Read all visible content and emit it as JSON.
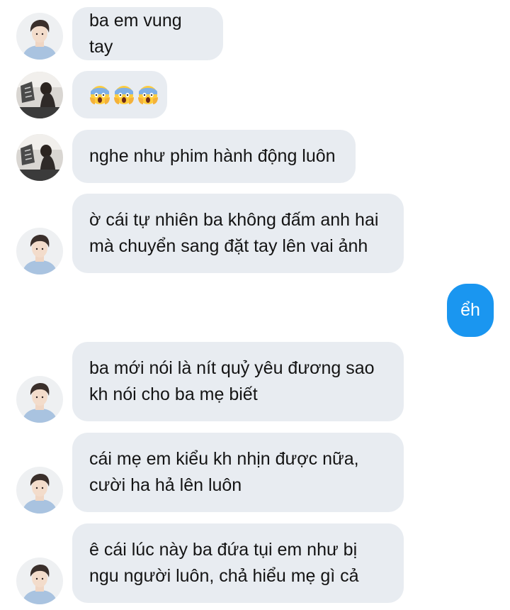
{
  "conversation": {
    "messages": [
      {
        "sender": "them",
        "avatar": "boy-avatar-icon",
        "text": "ba em vung tay"
      },
      {
        "sender": "them",
        "avatar": "girl-avatar-icon",
        "emojis": [
          "scream-emoji-icon",
          "scream-emoji-icon",
          "scream-emoji-icon"
        ]
      },
      {
        "sender": "them",
        "avatar": "girl-avatar-icon",
        "text": "nghe như phim hành động luôn"
      },
      {
        "sender": "them",
        "avatar": "boy-avatar-icon",
        "text": "ờ cái tự nhiên ba không đấm anh hai\nmà chuyển sang đặt tay lên vai ảnh"
      },
      {
        "sender": "me",
        "text": "ểh"
      },
      {
        "sender": "them",
        "avatar": "boy-avatar-icon",
        "text": "ba mới nói là nít quỷ yêu đương sao\nkh nói cho ba mẹ biết"
      },
      {
        "sender": "them",
        "avatar": "boy-avatar-icon",
        "text": "cái mẹ em kiểu kh nhịn được nữa,\ncười ha hả lên luôn"
      },
      {
        "sender": "them",
        "avatar": "boy-avatar-icon",
        "text": "ê cái lúc này ba đứa tụi em như bị\nngu người luôn, chả hiểu mẹ gì cả"
      }
    ]
  },
  "colors": {
    "incoming_bubble": "#e8ecf1",
    "outgoing_bubble": "#1a96f0",
    "text_dark": "#141414",
    "text_light": "#ffffff"
  }
}
